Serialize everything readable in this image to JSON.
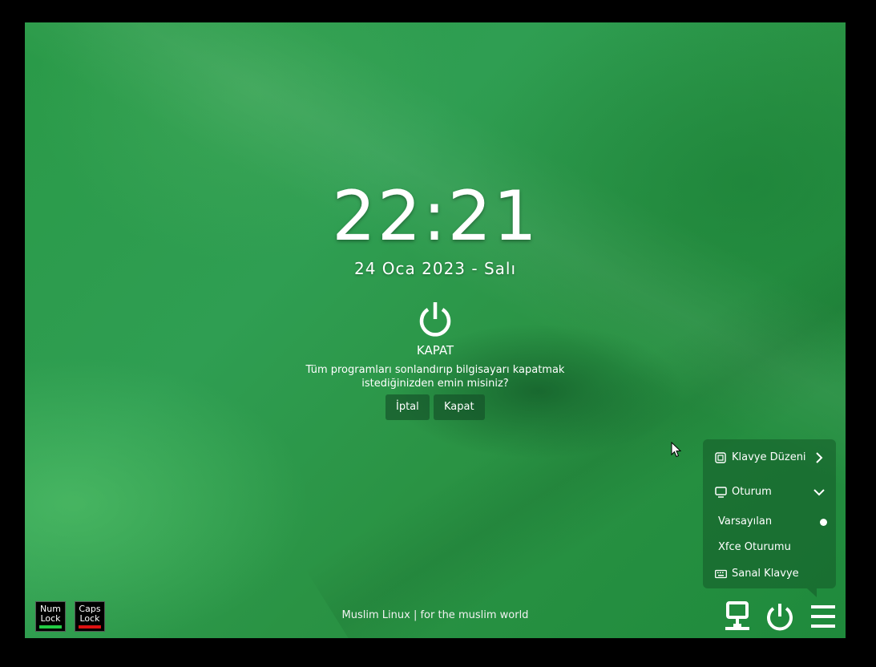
{
  "clock": {
    "time": "22:21",
    "date": "24 Oca 2023 - Salı"
  },
  "dialog": {
    "title": "KAPAT",
    "message": "Tüm programları sonlandırıp bilgisayarı kapatmak istediğinizden emin misiniz?",
    "cancel_label": "İptal",
    "confirm_label": "Kapat"
  },
  "popup": {
    "keyboard_layout_label": "Klavye Düzeni",
    "session_label": "Oturum",
    "sessions": [
      {
        "label": "Varsayılan",
        "selected": true
      },
      {
        "label": "Xfce Oturumu",
        "selected": false
      }
    ],
    "virtual_keyboard_label": "Sanal Klavye"
  },
  "locks": {
    "num_lock": {
      "line1": "Num",
      "line2": "Lock",
      "color": "#22cc44"
    },
    "caps_lock": {
      "line1": "Caps",
      "line2": "Lock",
      "color": "#dd1111"
    }
  },
  "footer": {
    "text": "Muslim Linux | for the muslim world"
  },
  "icons": [
    "network-icon",
    "power-icon",
    "menu-icon",
    "keyboard-layout-icon",
    "monitor-icon",
    "keyboard-icon"
  ],
  "colors": {
    "background": "#2a9a48",
    "popup": "#1d6a34"
  }
}
